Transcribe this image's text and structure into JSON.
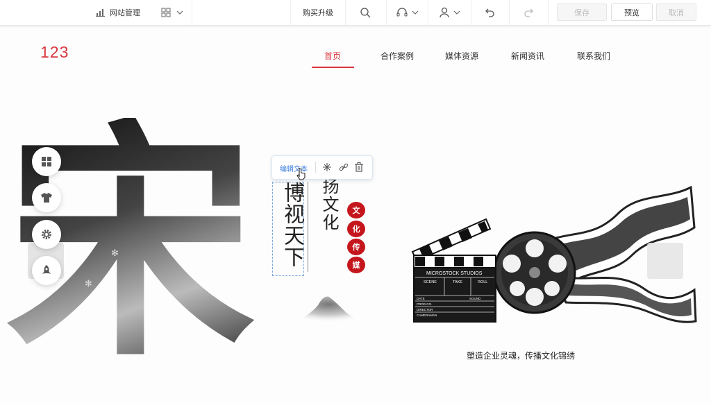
{
  "toolbar": {
    "site_manage": "网站管理",
    "upgrade": "购买升级",
    "save": "保存",
    "preview": "预览",
    "cancel": "取消"
  },
  "site": {
    "logo": "123",
    "nav": [
      "首页",
      "合作案例",
      "媒体资源",
      "新闻资讯",
      "联系我们"
    ]
  },
  "hero": {
    "big_char": "宋",
    "col1": "博视天下",
    "col2": "扬文化",
    "seals": [
      "文",
      "化",
      "传",
      "媒"
    ],
    "caption": "塑造企业灵魂，传播文化锦绣"
  },
  "edit_toolbar": {
    "edit_text": "编辑文本"
  },
  "clapper": {
    "studio": "MICROSTOCK STUDIOS",
    "scene": "SCENE",
    "take": "TAKE",
    "roll": "ROLL",
    "date": "DATE",
    "sound": "SOUND",
    "prod": "PROD.CO.",
    "director": "DIRECTOR",
    "camera": "CAMERAMAN"
  },
  "colors": {
    "accent": "#d9363e",
    "seal": "#c4161c",
    "link": "#3b7ddd"
  }
}
